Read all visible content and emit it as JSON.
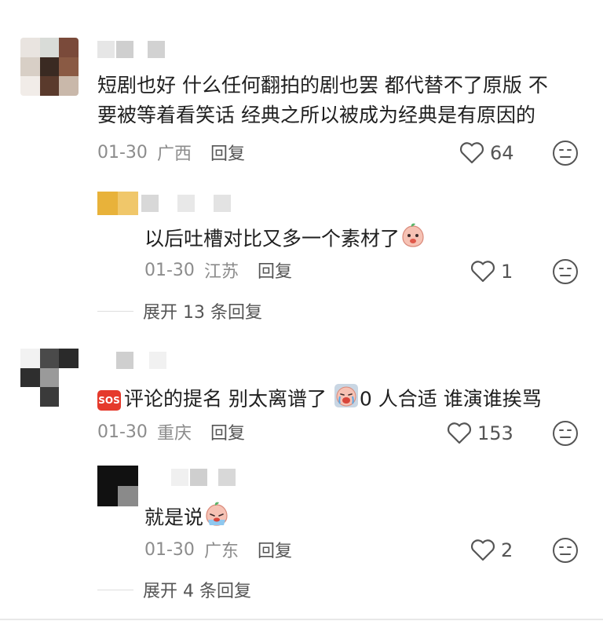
{
  "comments": [
    {
      "text_lines": [
        "短剧也好 什么任何翻拍的剧也罢 都代替不了原版 不",
        "要被等着看笑话 经典之所以被成为经典是有原因的"
      ],
      "date": "01-30",
      "location": "广西",
      "reply_label": "回复",
      "likes": "64"
    },
    {
      "text": "以后吐槽对比又多一个素材了",
      "date": "01-30",
      "location": "江苏",
      "reply_label": "回复",
      "likes": "1",
      "expand_label": "展开 13 条回复"
    },
    {
      "text_a": "评论的提名 别太离谱了 ",
      "text_b": "0 人合适 谁演谁挨骂",
      "date": "01-30",
      "location": "重庆",
      "reply_label": "回复",
      "likes": "153"
    },
    {
      "text": "就是说",
      "date": "01-30",
      "location": "广东",
      "reply_label": "回复",
      "likes": "2",
      "expand_label": "展开 4 条回复"
    }
  ],
  "sos_badge": "SOS",
  "icons": {
    "like": "heart-outline-icon",
    "dislike": "neutral-face-icon",
    "emoji_peach": "peach-emoji",
    "emoji_crying": "crying-face-emoji",
    "sos": "sos-badge-icon"
  },
  "colors": {
    "text": "#1f1f1f",
    "meta": "#8c8c8c",
    "reply": "#555555",
    "sos_red": "#e53a2c"
  }
}
